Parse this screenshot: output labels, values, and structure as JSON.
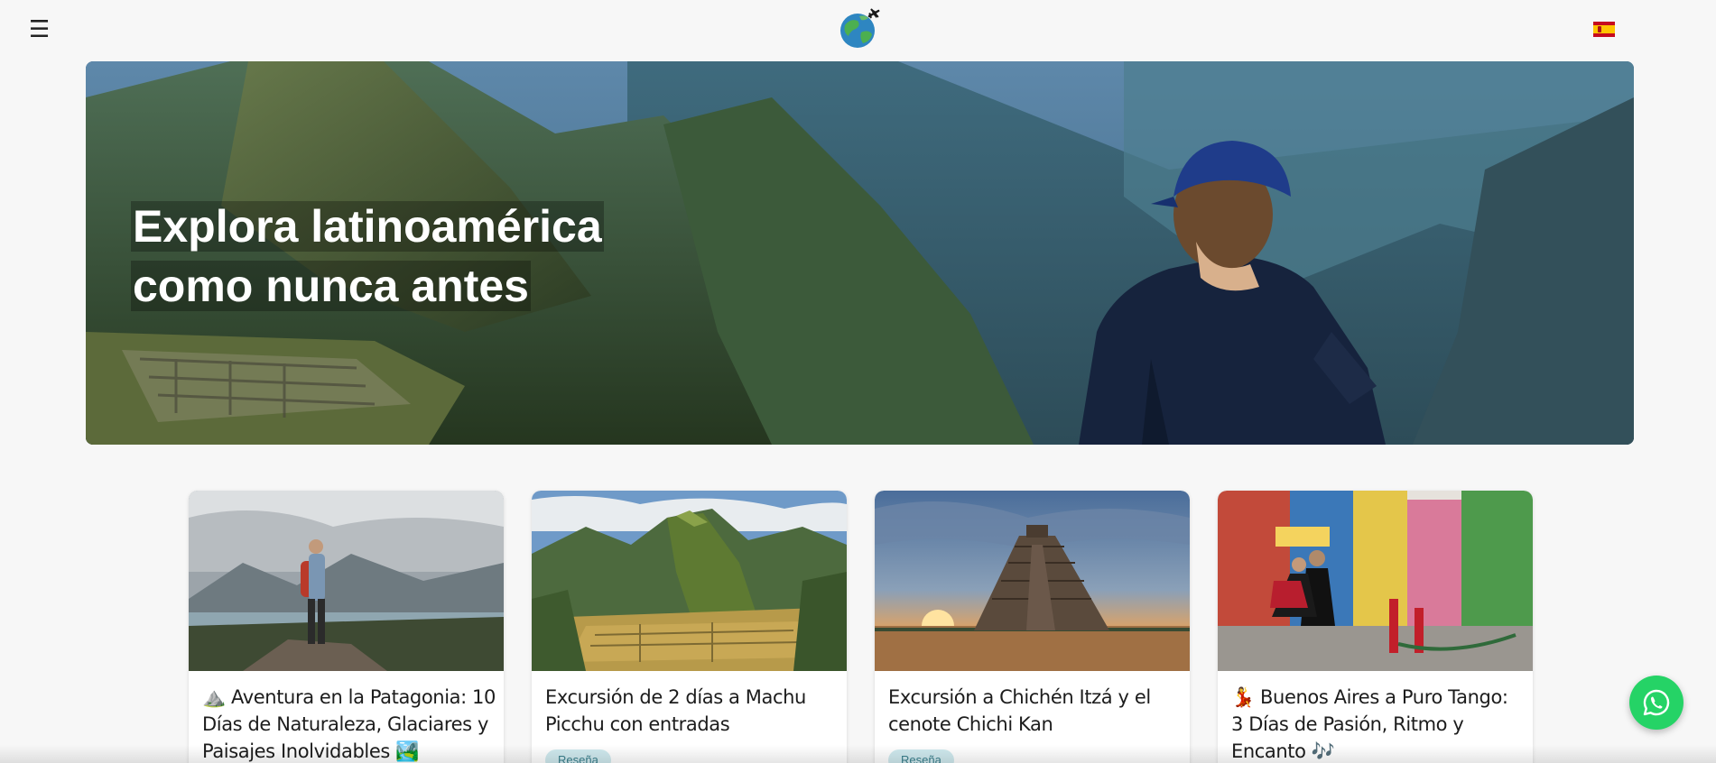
{
  "header": {
    "menu_icon": "hamburger-menu-icon",
    "menu_glyph": "☰",
    "logo_icon": "globe-airplane-logo",
    "language_icon": "spain-flag-icon"
  },
  "hero": {
    "title_line1": "Explora latinoamérica",
    "title_line2": "como nunca antes"
  },
  "tours": [
    {
      "title": "⛰️ Aventura en la Patagonia: 10 Días de Naturaleza, Glaciares y Paisajes Inolvidables 🏞️",
      "tag": ""
    },
    {
      "title": "Excursión de 2 días a Machu Picchu con entradas",
      "tag": "Reseña"
    },
    {
      "title": "Excursión a Chichén Itzá y el cenote Chichi Kan",
      "tag": "Reseña"
    },
    {
      "title": "💃 Buenos Aires a Puro Tango: 3 Días de Pasión, Ritmo y Encanto 🎶",
      "tag": ""
    }
  ],
  "whatsapp": {
    "icon": "whatsapp-icon"
  },
  "colors": {
    "background": "#f7f7f7",
    "whatsapp_green": "#25d366",
    "tag_bg": "#cfe9ee",
    "tag_text": "#3a7f8c"
  }
}
